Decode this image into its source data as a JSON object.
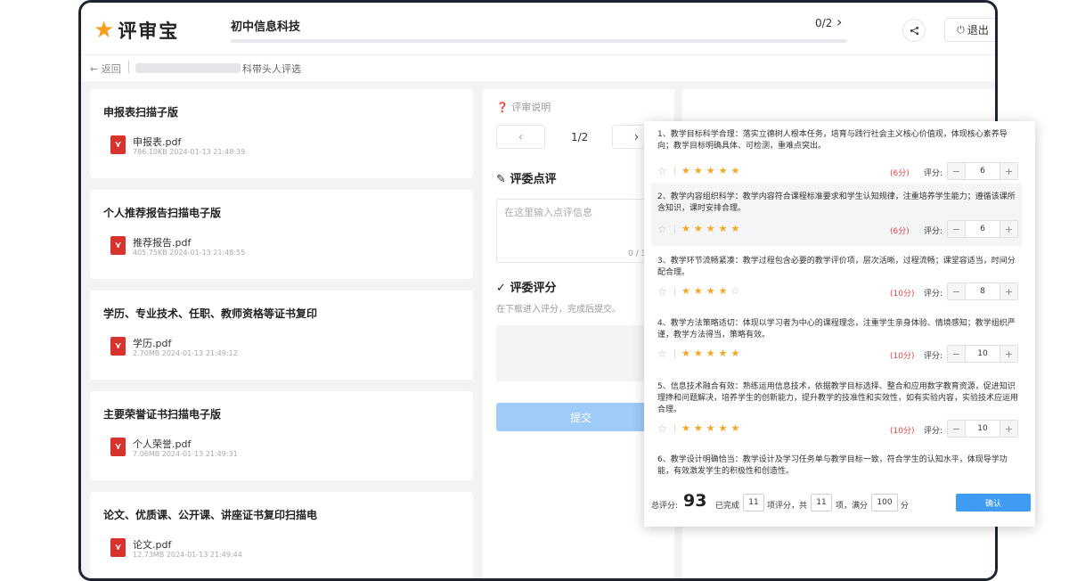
{
  "app": {
    "brand": "评审宝",
    "logo_icon": "star-icon"
  },
  "header": {
    "course_title": "初中信息科技",
    "progress": "0/2",
    "progress_fraction": 0,
    "logout_label": "退出"
  },
  "breadcrumb": {
    "back_label": "返回",
    "path_tail": "科带头人评选"
  },
  "documents": [
    {
      "title": "申报表扫描子版",
      "file": "申报表.pdf",
      "meta": "786.10KB 2024-01-13 21:48:39"
    },
    {
      "title": "个人推荐报告扫描电子版",
      "file": "推荐报告.pdf",
      "meta": "405.75KB 2024-01-13 21:48:55"
    },
    {
      "title": "学历、专业技术、任职、教师资格等证书复印扫",
      "file": "学历.pdf",
      "meta": "2.70MB 2024-01-13 21:49:12"
    },
    {
      "title": "主要荣誉证书扫描电子版",
      "file": "个人荣誉.pdf",
      "meta": "7.06MB 2024-01-13 21:49:31"
    },
    {
      "title": "论文、优质课、公开课、讲座证书复印扫描电子",
      "file": "论文.pdf",
      "meta": "12.73MB 2024-01-13 21:49:44"
    }
  ],
  "review": {
    "note_label": "评审说明",
    "pager": "1/2",
    "comment_heading": "评委点评",
    "comment_placeholder": "在这里输入点评信息",
    "comment_count": "0 / 3",
    "score_heading": "评委评分",
    "score_hint": "在下框进入评分，完成后提交。",
    "submit_label": "提交"
  },
  "popup": {
    "score_label": "评分:",
    "criteria": [
      {
        "text": "1、教学目标科学合理：落实立德树人根本任务，培育与践行社会主义核心价值观，体现核心素养导向；教学目标明确具体、可检测，重难点突出。",
        "stars": 5,
        "points": "(6分)",
        "score": "6",
        "shaded": false
      },
      {
        "text": "2、教学内容组织科学：教学内容符合课程标准要求和学生认知规律，注重培养学生能力；遵循该课所含知识，课时安排合理。",
        "stars": 5,
        "points": "(6分)",
        "score": "6",
        "shaded": true
      },
      {
        "text": "3、教学环节流畅紧凑：教学过程包含必要的教学评价项，层次活晰，过程流畅；课堂容适当，时间分配合理。",
        "stars": 4,
        "points": "(10分)",
        "score": "8",
        "shaded": false
      },
      {
        "text": "4、教学方法策略适切：体现以学习者为中心的课程理念，注重学生亲身体验、情境感知；教学组织严谨，教学方法得当，策略有效。",
        "stars": 5,
        "points": "(10分)",
        "score": "10",
        "shaded": false
      },
      {
        "text": "5、信息技术融合有效：熟练运用信息技术，依据教学目标选择、整合和应用数字教育资源，促进知识理搀和问题解决，培养学生的创新能力，提升教学的技准性和实效性，如有实验内容，实验技术应运用合理。",
        "stars": 5,
        "points": "(10分)",
        "score": "10",
        "shaded": false
      },
      {
        "text": "6、教学设计明确恰当：教学设计及学习任务单与教学目标一致，符合学生的认知水平，体现导学功能，有效激发学生的积极性和创造性。"
      }
    ],
    "footer": {
      "total_label": "总评分:",
      "total": "93",
      "done_prefix": "已完成",
      "done_count": "11",
      "done_mid": "项评分，共",
      "total_items": "11",
      "items_suffix": "项，满分",
      "full_score": "100",
      "score_suffix": "分",
      "confirm_label": "确认"
    }
  },
  "colors": {
    "brand_star": "#f7a01d",
    "accent": "#3f9cf2",
    "star": "#f5a623",
    "points": "#e54545",
    "pdf": "#d8322c"
  }
}
